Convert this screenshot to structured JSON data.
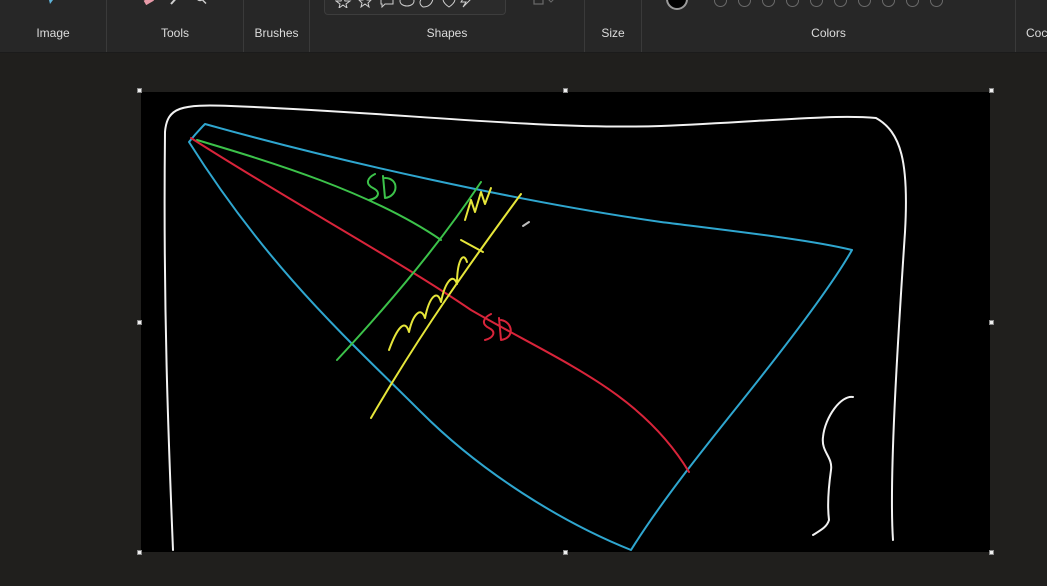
{
  "ribbon": {
    "groups": {
      "image": "Image",
      "tools": "Tools",
      "brushes": "Brushes",
      "shapes": "Shapes",
      "size": "Size",
      "colors": "Colors",
      "copilot_partial": "Coc"
    }
  },
  "colors": {
    "ribbon_bg": "#272727",
    "workspace_bg": "#201f1d",
    "canvas_bg": "#000000",
    "stroke_white": "#f2f2f2",
    "stroke_blue": "#2fa6cf",
    "stroke_green": "#3cc24a",
    "stroke_yellow": "#e6e63a",
    "stroke_red": "#d8243a"
  },
  "icons": [
    "image-icon",
    "eraser-icon",
    "pencil-icon",
    "magnifier-icon",
    "star-shape-icon",
    "callout-shape-icon",
    "heart-shape-icon",
    "lightning-shape-icon",
    "fill-style-icon"
  ]
}
